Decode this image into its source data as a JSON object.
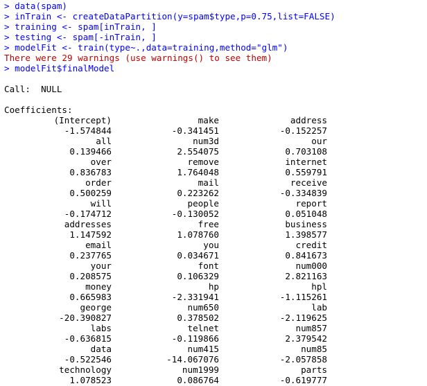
{
  "console": {
    "commands": [
      "> data(spam)",
      "> inTrain <- createDataPartition(y=spam$type,p=0.75,list=FALSE)",
      "> training <- spam[inTrain, ]",
      "> testing <- spam[-inTrain, ]",
      "> modelFit <- train(type~.,data=training,method=\"glm\")"
    ],
    "warning": "There were 29 warnings (use warnings() to see them)",
    "final_command": "> modelFit$finalModel",
    "call_line": "Call:  NULL",
    "coefficients_header": "Coefficients:",
    "coefficients": [
      [
        "(Intercept)",
        "make",
        "address"
      ],
      [
        "-1.574844",
        "-0.341451",
        "-0.152257"
      ],
      [
        "all",
        "num3d",
        "our"
      ],
      [
        "0.139466",
        "2.554075",
        "0.703108"
      ],
      [
        "over",
        "remove",
        "internet"
      ],
      [
        "0.836783",
        "1.764048",
        "0.559791"
      ],
      [
        "order",
        "mail",
        "receive"
      ],
      [
        "0.500259",
        "0.223262",
        "-0.334839"
      ],
      [
        "will",
        "people",
        "report"
      ],
      [
        "-0.174712",
        "-0.130052",
        "0.051048"
      ],
      [
        "addresses",
        "free",
        "business"
      ],
      [
        "1.147592",
        "1.078760",
        "1.398577"
      ],
      [
        "email",
        "you",
        "credit"
      ],
      [
        "0.237765",
        "0.034671",
        "0.841673"
      ],
      [
        "your",
        "font",
        "num000"
      ],
      [
        "0.208575",
        "0.106329",
        "2.821163"
      ],
      [
        "money",
        "hp",
        "hpl"
      ],
      [
        "0.665983",
        "-2.331941",
        "-1.115261"
      ],
      [
        "george",
        "num650",
        "lab"
      ],
      [
        "-20.390827",
        "0.378502",
        "-2.119625"
      ],
      [
        "labs",
        "telnet",
        "num857"
      ],
      [
        "-0.636815",
        "-0.119866",
        "2.379542"
      ],
      [
        "data",
        "num415",
        "num85"
      ],
      [
        "-0.522546",
        "-14.067076",
        "-2.057858"
      ],
      [
        "technology",
        "num1999",
        "parts"
      ],
      [
        "1.078523",
        "0.086764",
        "-0.619777"
      ]
    ]
  },
  "colors": {
    "command": "#0000ff",
    "warning": "#c00000",
    "output": "#000000",
    "background": "#ffffff"
  }
}
